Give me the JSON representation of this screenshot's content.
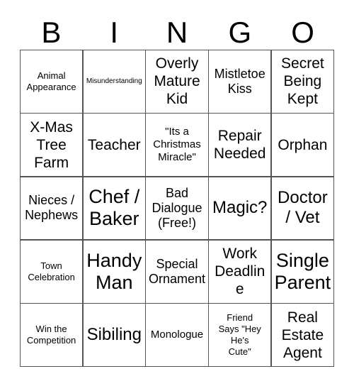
{
  "card": {
    "header_letters": [
      "B",
      "I",
      "N",
      "G",
      "O"
    ],
    "colors": {
      "background": "#ffffff",
      "cell_background": "#ffffff",
      "border": "#555555",
      "text": "#000000"
    },
    "grid": {
      "columns": 5,
      "rows": 5,
      "free_space_index": 12
    },
    "cells": [
      {
        "text": "Animal\nAppearance",
        "size": "xs",
        "free": false
      },
      {
        "text": "Misunderstanding",
        "size": "xxs",
        "free": false
      },
      {
        "text": "Overly\nMature\nKid",
        "size": "lg",
        "free": false
      },
      {
        "text": "Mistletoe\nKiss",
        "size": "md",
        "free": false
      },
      {
        "text": "Secret\nBeing\nKept",
        "size": "lg",
        "free": false
      },
      {
        "text": "X-Mas\nTree\nFarm",
        "size": "lg",
        "free": false
      },
      {
        "text": "Teacher",
        "size": "lg",
        "free": false
      },
      {
        "text": "\"Its a\nChristmas\nMiracle\"",
        "size": "sm",
        "free": false
      },
      {
        "text": "Repair\nNeeded",
        "size": "lg",
        "free": false
      },
      {
        "text": "Orphan",
        "size": "lg",
        "free": false
      },
      {
        "text": "Nieces /\nNephews",
        "size": "md",
        "free": false
      },
      {
        "text": "Chef /\nBaker",
        "size": "xxl",
        "free": false
      },
      {
        "text": "Bad\nDialogue\n(Free!)",
        "size": "md",
        "free": true
      },
      {
        "text": "Magic?",
        "size": "xl",
        "free": false
      },
      {
        "text": "Doctor\n/ Vet",
        "size": "xl",
        "free": false
      },
      {
        "text": "Town\nCelebration",
        "size": "xs",
        "free": false
      },
      {
        "text": "Handy\nMan",
        "size": "xxl",
        "free": false
      },
      {
        "text": "Special\nOrnament",
        "size": "md",
        "free": false
      },
      {
        "text": "Work\nDeadline",
        "size": "lg",
        "free": false
      },
      {
        "text": "Single\nParent",
        "size": "xxl",
        "free": false
      },
      {
        "text": "Win the\nCompetition",
        "size": "xs",
        "free": false
      },
      {
        "text": "Sibiling",
        "size": "xl",
        "free": false
      },
      {
        "text": "Monologue",
        "size": "sm",
        "free": false
      },
      {
        "text": "Friend\nSays \"Hey\nHe's\nCute\"",
        "size": "xs",
        "free": false
      },
      {
        "text": "Real\nEstate\nAgent",
        "size": "lg",
        "free": false
      }
    ]
  }
}
